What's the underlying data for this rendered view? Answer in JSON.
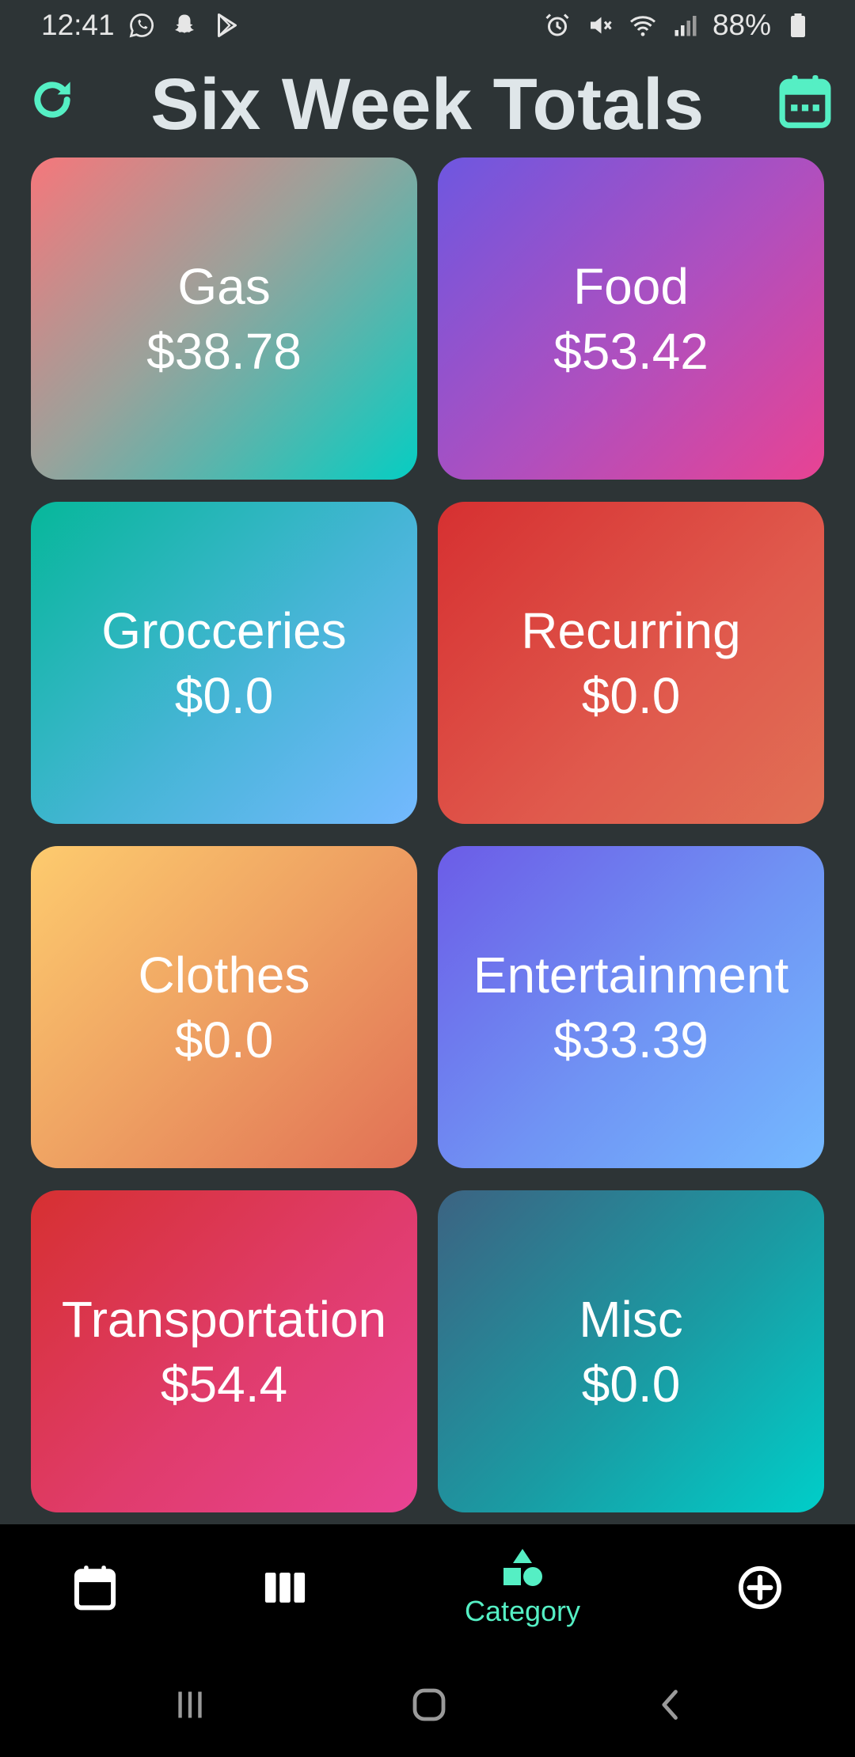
{
  "status_bar": {
    "time": "12:41",
    "battery": "88%",
    "left_icons": [
      "whatsapp-icon",
      "snapchat-icon",
      "play-store-icon"
    ],
    "right_icons": [
      "alarm-icon",
      "mute-icon",
      "wifi-icon",
      "signal-icon",
      "battery-icon"
    ]
  },
  "header": {
    "title": "Six Week Totals",
    "left_icon": "refresh-icon",
    "right_icon": "calendar-icon"
  },
  "categories": [
    {
      "name": "Gas",
      "amount": "$38.78"
    },
    {
      "name": "Food",
      "amount": "$53.42"
    },
    {
      "name": "Grocceries",
      "amount": "$0.0"
    },
    {
      "name": "Recurring",
      "amount": "$0.0"
    },
    {
      "name": "Clothes",
      "amount": "$0.0"
    },
    {
      "name": "Entertainment",
      "amount": "$33.39"
    },
    {
      "name": "Transportation",
      "amount": "$54.4"
    },
    {
      "name": "Misc",
      "amount": "$0.0"
    }
  ],
  "bottom_nav": {
    "items": [
      {
        "icon": "calendar-icon",
        "label": ""
      },
      {
        "icon": "columns-icon",
        "label": ""
      },
      {
        "icon": "shapes-icon",
        "label": "Category",
        "active": true
      },
      {
        "icon": "add-circle-icon",
        "label": ""
      }
    ]
  },
  "colors": {
    "background": "#2d3436",
    "accent": "#55efc4",
    "title": "#dfe6e9"
  }
}
